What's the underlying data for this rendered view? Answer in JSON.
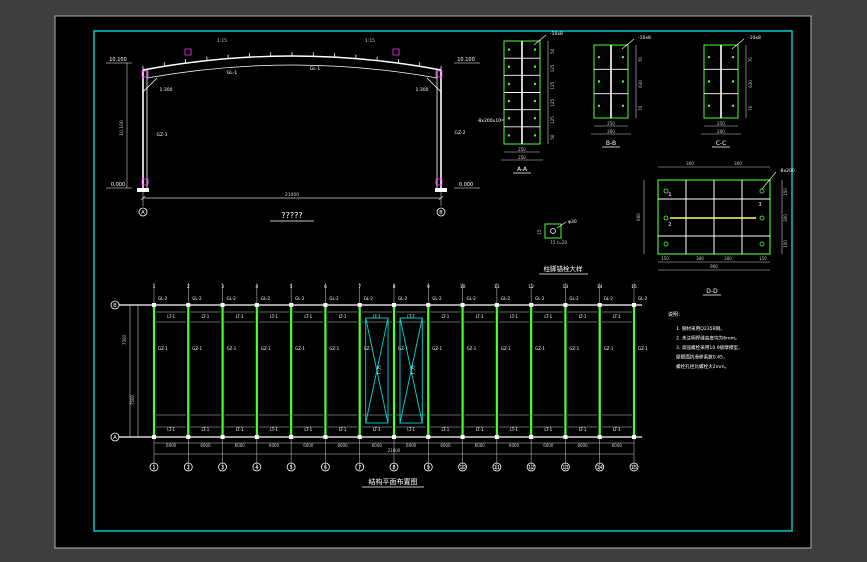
{
  "colors": {
    "background": "#3e3e3e",
    "paper": "#000000",
    "frame": "#00d8d8",
    "steel": "#ffffff",
    "members": "#4cff33",
    "dimensions": "#cfcfcf",
    "magenta": "#ff33ff",
    "highlight": "#ffff66"
  },
  "elevation": {
    "title": "?????",
    "span_dim": "21000",
    "left_ridge_scale": "1:15",
    "right_ridge_scale": "1:15",
    "left_eave_level": "10.100",
    "right_eave_level": "10.100",
    "left_floor_level": "0.000",
    "right_floor_level": "0.000",
    "left_column_height": "10.100",
    "left_column_mark": "GZ-1",
    "right_column_mark": "GZ-2",
    "left_rafter_mark": "GL-1",
    "right_rafter_mark": "GL-1",
    "left_haunch_dim": "1:300",
    "right_haunch_dim": "1:300",
    "axis_left": "A",
    "axis_right": "B"
  },
  "section_a": {
    "title": "A-A",
    "plate_label": "-10x8",
    "dim_top": "250",
    "dim_bottom": "250",
    "side_label": "-8x200x10",
    "side_dims": [
      "50",
      "125",
      "125",
      "125",
      "125",
      "50"
    ]
  },
  "section_b": {
    "title": "B-B",
    "plate_label": "-10x8",
    "dim_top": "250",
    "dim_bottom": "200",
    "side_dims": [
      "70",
      "630",
      "70"
    ]
  },
  "section_c": {
    "title": "C-C",
    "plate_label": "-10x8",
    "dim_top": "250",
    "dim_bottom": "200",
    "side_dims": [
      "70",
      "630",
      "70"
    ]
  },
  "section_d": {
    "title": "D-D",
    "top_dims": [
      "300",
      "300"
    ],
    "bottom_dims": [
      "150",
      "300",
      "300",
      "150"
    ],
    "total": "900",
    "height_dim": "600",
    "side_dims": [
      "150",
      "300",
      "150"
    ],
    "callout": "-8x200",
    "marks": [
      "1",
      "2",
      "3"
    ]
  },
  "anchor_detail": {
    "title": "柱脚锚栓大样",
    "hole_label": "φ30",
    "plate_label": "t=20",
    "dims": [
      "15",
      "15"
    ]
  },
  "plan": {
    "title": "结构平面布置图",
    "total_dim": "21000",
    "left_dims": [
      "7500",
      "7500"
    ],
    "bay_dims": [
      "6000",
      "6000",
      "6000",
      "6000",
      "6000",
      "6000",
      "6000",
      "6000",
      "6000",
      "6000",
      "6000",
      "6000",
      "6000",
      "6000"
    ],
    "axes": [
      "1",
      "2",
      "3",
      "4",
      "5",
      "6",
      "7",
      "8",
      "9",
      "10",
      "11",
      "12",
      "13",
      "14",
      "15"
    ],
    "row_axes": [
      "B",
      "A"
    ],
    "purlin_label": "LT-1",
    "brace_label": "SC-1",
    "column_label": "GZ-1",
    "purlin_mark": "GL-2",
    "bracing_bays": [
      6,
      7
    ]
  },
  "notes": {
    "title": "说明：",
    "lines": [
      "1. 钢材采用Q235B钢。",
      "2. 未注明焊缝高度均为6mm。",
      "3. 高强螺栓采用10.9级摩擦型，",
      "摩擦面抗滑移系数0.45，",
      "螺栓孔径比螺栓大2mm。"
    ]
  }
}
